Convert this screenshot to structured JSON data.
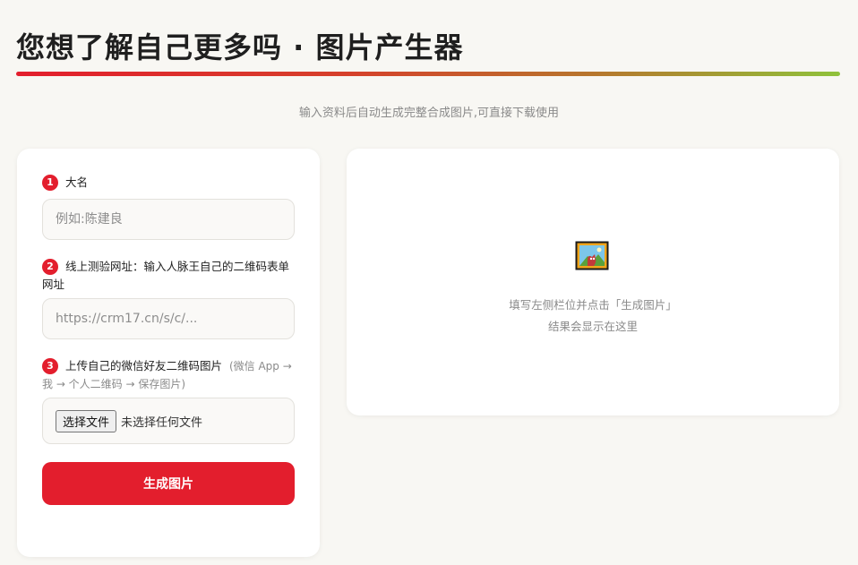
{
  "header": {
    "title": "您想了解自己更多吗 · 图片产生器",
    "subtitle": "输入资料后自动生成完整合成图片,可直接下载使用"
  },
  "form": {
    "fields": [
      {
        "step": "1",
        "label": "大名",
        "placeholder": "例如:陈建良",
        "value": ""
      },
      {
        "step": "2",
        "label": "线上测验网址：输入人脉王自己的二维码表单网址",
        "placeholder": "https://crm17.cn/s/c/...",
        "value": ""
      }
    ],
    "upload": {
      "step": "3",
      "label": "上传自己的微信好友二维码图片",
      "hint": "(微信 App → 我 → 个人二维码 → 保存图片)",
      "button_label": "选择文件",
      "status": "未选择任何文件"
    },
    "generate_label": "生成图片"
  },
  "preview": {
    "icon": "framed-picture-icon",
    "hint_line1": "填写左侧栏位并点击「生成图片」",
    "hint_line2": "结果会显示在这里"
  },
  "colors": {
    "accent": "#e31e2d",
    "gradient_end": "#8fc23b",
    "background": "#f8f7f3"
  }
}
